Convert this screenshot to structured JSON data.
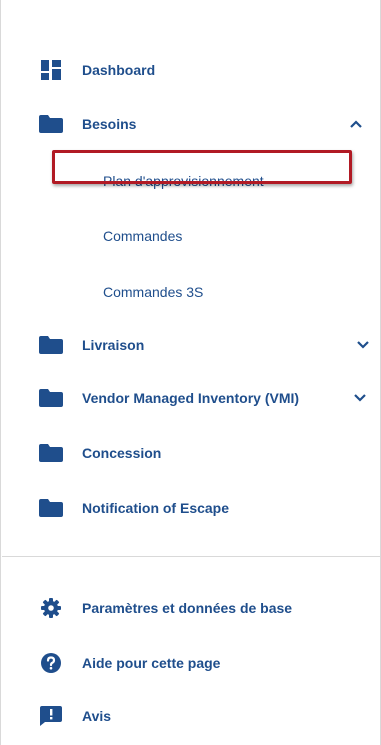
{
  "menu": {
    "dashboard": {
      "label": "Dashboard",
      "icon": "dashboard-icon"
    },
    "besoins": {
      "label": "Besoins",
      "icon": "folder-icon",
      "expanded": true,
      "children": [
        {
          "label": "Plan d'approvisionnement",
          "highlighted": true
        },
        {
          "label": "Commandes"
        },
        {
          "label": "Commandes 3S"
        }
      ]
    },
    "livraison": {
      "label": "Livraison",
      "icon": "folder-icon",
      "expanded": false
    },
    "vmi": {
      "label": "Vendor Managed Inventory (VMI)",
      "icon": "folder-icon",
      "expanded": false
    },
    "concession": {
      "label": "Concession",
      "icon": "folder-icon"
    },
    "notification": {
      "label": "Notification of Escape",
      "icon": "folder-icon"
    }
  },
  "footer": {
    "settings": {
      "label": "Paramètres et données de base",
      "icon": "gear-icon"
    },
    "help": {
      "label": "Aide pour cette page",
      "icon": "help-icon"
    },
    "feedback": {
      "label": "Avis",
      "icon": "feedback-icon"
    }
  },
  "colors": {
    "text": "#1f4e8c",
    "icon": "#1f4e8c",
    "highlight_border": "#b11a24",
    "divider": "#d9d9d9"
  }
}
